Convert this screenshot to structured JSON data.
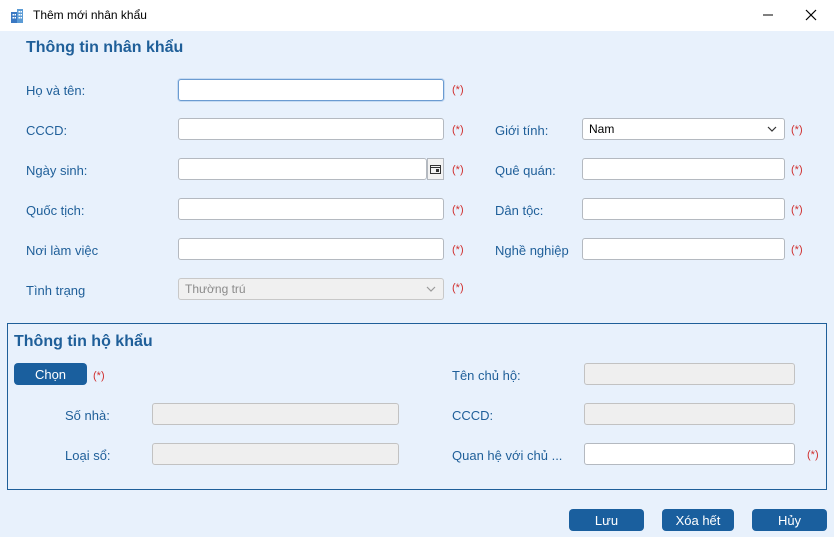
{
  "window": {
    "title": "Thêm mới nhân khẩu"
  },
  "person_section": {
    "title": "Thông tin nhân khẩu",
    "fields": {
      "fullname": {
        "label": "Họ và tên:",
        "value": ""
      },
      "cccd": {
        "label": "CCCD:",
        "value": ""
      },
      "dob": {
        "label": "Ngày sinh:",
        "value": ""
      },
      "nationality": {
        "label": "Quốc tịch:",
        "value": ""
      },
      "workplace": {
        "label": "Nơi làm việc",
        "value": ""
      },
      "status": {
        "label": "Tình trạng",
        "value": "Thường trú"
      },
      "gender": {
        "label": "Giới tính:",
        "value": "Nam"
      },
      "hometown": {
        "label": "Quê quán:",
        "value": ""
      },
      "ethnicity": {
        "label": "Dân tộc:",
        "value": ""
      },
      "occupation": {
        "label": "Nghề nghiệp",
        "value": ""
      }
    },
    "required_mark": "(*)"
  },
  "household_section": {
    "title": "Thông tin hộ khẩu",
    "choose_button": "Chọn",
    "house_number_label": "Số nhà:",
    "book_type_label": "Loại sổ:",
    "head_name_label": "Tên chủ hộ:",
    "head_cccd_label": "CCCD:",
    "relation_label": "Quan hệ với chủ ..."
  },
  "footer": {
    "save": "Lưu",
    "clear": "Xóa hết",
    "cancel": "Hủy"
  },
  "icons": {
    "app": "building-icon",
    "calendar": "calendar-icon",
    "dropdown": "chevron-down-icon"
  }
}
